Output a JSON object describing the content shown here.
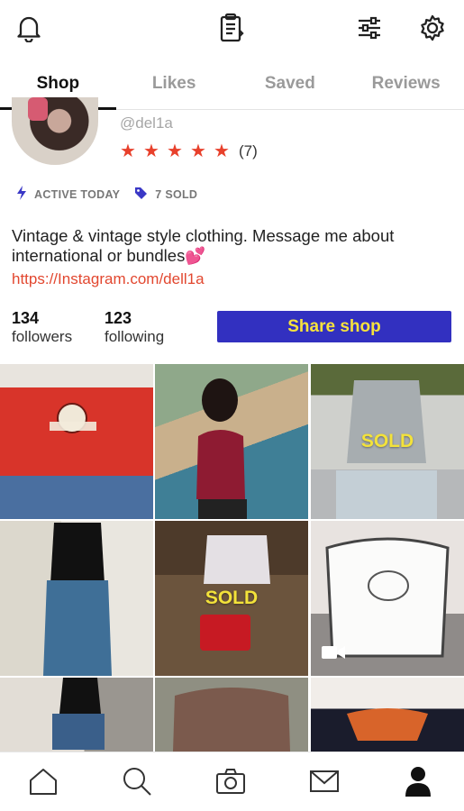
{
  "tabs": [
    {
      "label": "Shop",
      "active": true
    },
    {
      "label": "Likes",
      "active": false
    },
    {
      "label": "Saved",
      "active": false
    },
    {
      "label": "Reviews",
      "active": false
    }
  ],
  "profile": {
    "handle": "@del1a",
    "rating_stars": 5,
    "review_count": "(7)",
    "activity": "ACTIVE TODAY",
    "sold": "7 SOLD",
    "bio": "Vintage & vintage style clothing. Message me about international or bundles💕",
    "link": "https://Instagram.com/dell1a",
    "followers_count": "134",
    "followers_label": "followers",
    "following_count": "123",
    "following_label": "following",
    "share_button": "Share shop"
  },
  "listings": [
    {
      "sold": false,
      "overlay": ""
    },
    {
      "sold": false,
      "overlay": ""
    },
    {
      "sold": true,
      "overlay": "SOLD"
    },
    {
      "sold": false,
      "overlay": ""
    },
    {
      "sold": true,
      "overlay": "SOLD"
    },
    {
      "sold": false,
      "overlay": "",
      "video": true
    },
    {
      "sold": false,
      "overlay": ""
    },
    {
      "sold": false,
      "overlay": ""
    },
    {
      "sold": false,
      "overlay": ""
    }
  ],
  "icons": {
    "top_left": "bell-icon",
    "top_center": "clipboard-icon",
    "top_filters": "sliders-icon",
    "top_settings": "gear-icon",
    "nav": [
      "home-icon",
      "search-icon",
      "camera-icon",
      "mail-icon",
      "profile-icon"
    ]
  },
  "colors": {
    "accent_red": "#e8402b",
    "share_button_bg": "#3230c0",
    "share_button_text": "#f6e23c",
    "sold_text": "#f3e23a"
  }
}
